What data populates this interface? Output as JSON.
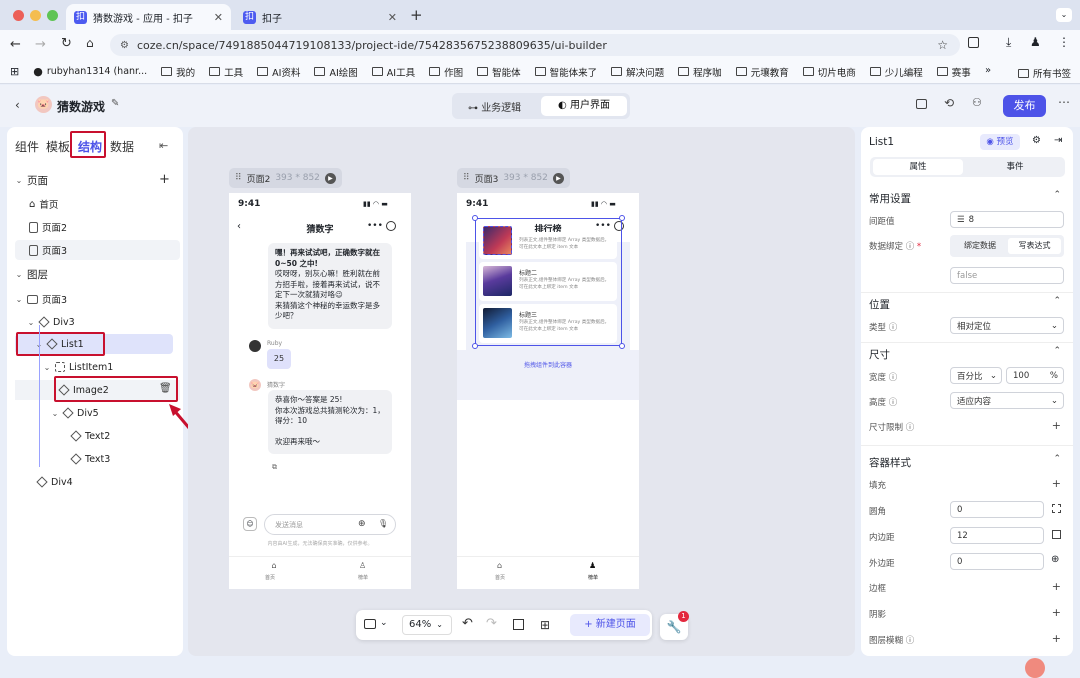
{
  "browser": {
    "tabs": [
      {
        "title": "猜数游戏 - 应用 - 扣子",
        "active": true
      },
      {
        "title": "扣子",
        "active": false
      }
    ],
    "url": "coze.cn/space/7491885044719108133/project-ide/7542835675238809635/ui-builder",
    "bookmarks": [
      "rubyhan1314 (hanr...",
      "我的",
      "工具",
      "AI资料",
      "AI绘图",
      "AI工具",
      "作图",
      "智能体",
      "智能体来了",
      "解决问题",
      "程序咖",
      "元壤教育",
      "切片电商",
      "少儿编程",
      "赛事"
    ],
    "bookmarks_more": "所有书签"
  },
  "app": {
    "name": "猜数游戏",
    "mode_tabs": [
      "业务逻辑",
      "用户界面"
    ],
    "active_mode": "用户界面",
    "publish_label": "发布"
  },
  "left_panel": {
    "tabs": [
      "组件",
      "模板",
      "结构",
      "数据"
    ],
    "active_tab": "结构",
    "pages_title": "页面",
    "pages": [
      "首页",
      "页面2",
      "页面3"
    ],
    "layers_title": "图层",
    "layers": [
      {
        "label": "页面3",
        "kind": "page"
      },
      {
        "label": "Div3",
        "kind": "div"
      },
      {
        "label": "List1",
        "kind": "list"
      },
      {
        "label": "ListItem1",
        "kind": "item"
      },
      {
        "label": "Image2",
        "kind": "image"
      },
      {
        "label": "Div5",
        "kind": "div"
      },
      {
        "label": "Text2",
        "kind": "text"
      },
      {
        "label": "Text3",
        "kind": "text"
      },
      {
        "label": "Div4",
        "kind": "div"
      }
    ]
  },
  "canvas": {
    "page2": {
      "label": "页面2",
      "size": "393 * 852",
      "time": "9:41",
      "title": "猜数字",
      "bubble1": [
        "嘿！再来试试吧，正确数字就在",
        "0~50 之中!",
        "哎呀呀，别灰心嘛！胜利就在前",
        "方招手啦，接着再来试试，说不",
        "定下一次就猜对咯😉",
        "来猜猜这个神秘的幸运数字是多",
        "少吧？"
      ],
      "user_name": "Ruby",
      "user_msg": "25",
      "bot_name": "猜数字",
      "bubble2": [
        "恭喜你～答案是 25!",
        "你本次游戏总共猜测轮次为：1，",
        "得分：10",
        "",
        "欢迎再来哦～"
      ],
      "input_placeholder": "发送消息",
      "disclaimer": "内容由AI生成，无法确保真实准确，仅供参考。",
      "nav": [
        "首页",
        "榜单"
      ]
    },
    "page3": {
      "label": "页面3",
      "size": "393 * 852",
      "time": "9:41",
      "title": "排行榜",
      "items": [
        {
          "title": "",
          "desc": "列表正文,组件整体绑定 Array 类型数据后，可在此文本上绑定 item 文本"
        },
        {
          "title": "标题二",
          "desc": "列表正文,组件整体绑定 Array 类型数据后，可在此文本上绑定 item 文本"
        },
        {
          "title": "标题三",
          "desc": "列表正文,组件整体绑定 Array 类型数据后，可在此文本上绑定 item 文本"
        }
      ],
      "drop_hint": "拖拽组件到此容器",
      "nav": [
        "首页",
        "榜单"
      ]
    },
    "zoom": "64%",
    "new_page_label": "新建页面",
    "notification_count": "1"
  },
  "right_panel": {
    "component": "List1",
    "preview_label": "预览",
    "tabs": [
      "属性",
      "事件"
    ],
    "common_title": "常用设置",
    "spacing_label": "间距值",
    "spacing_value": "8",
    "binding_label": "数据绑定",
    "binding_options": [
      "绑定数据",
      "写表达式"
    ],
    "binding_value": "false",
    "position_title": "位置",
    "type_label": "类型",
    "type_value": "相对定位",
    "size_title": "尺寸",
    "width_label": "宽度",
    "width_unit": "百分比",
    "width_value": "100",
    "width_suffix": "%",
    "height_label": "高度",
    "height_value": "适应内容",
    "size_limit_label": "尺寸限制",
    "container_title": "容器样式",
    "fill_label": "填充",
    "radius_label": "圆角",
    "radius_value": "0",
    "padding_label": "内边距",
    "padding_value": "12",
    "margin_label": "外边距",
    "margin_value": "0",
    "border_label": "边框",
    "shadow_label": "阴影",
    "blur_label": "图层模糊"
  },
  "colors": {
    "accent": "#4d53e8",
    "highlight_red": "#c8102e",
    "selected_row": "#dfe3fb"
  }
}
